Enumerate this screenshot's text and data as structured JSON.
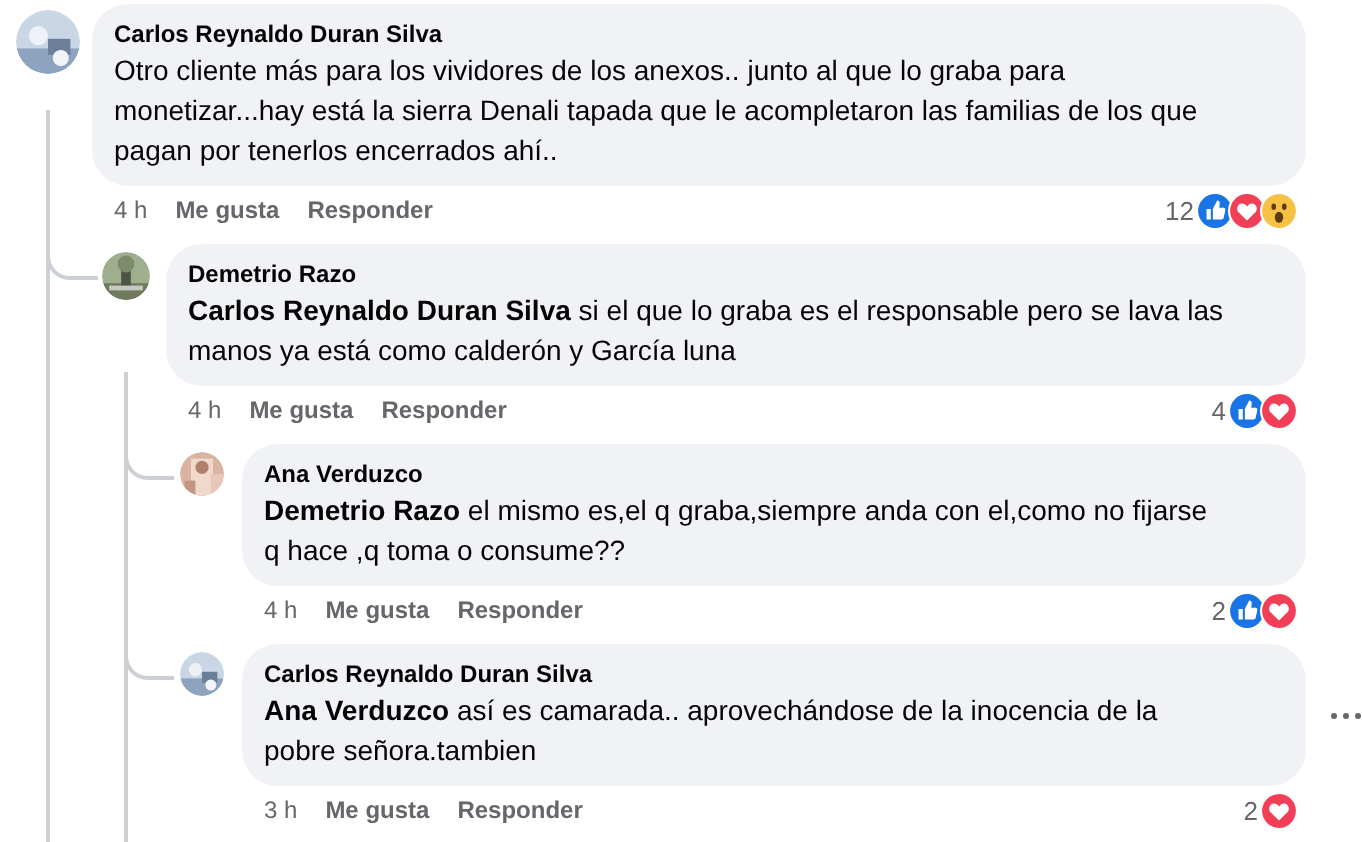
{
  "comments": [
    {
      "author": "Carlos Reynaldo Duran Silva",
      "text": "Otro cliente más para los vividores de los anexos.. junto al que lo graba para monetizar...hay está la sierra Denali tapada que le acompletaron las familias de los que pagan por tenerlos encerrados ahí..",
      "time": "4 h",
      "like": "Me gusta",
      "reply": "Responder",
      "reaction_count": "12",
      "reactions": [
        {
          "kind": "like"
        },
        {
          "kind": "love"
        },
        {
          "kind": "wow"
        }
      ],
      "avatar": {
        "kind": "picture"
      },
      "children": [
        {
          "author": "Demetrio Razo",
          "text": "**Carlos Reynaldo Duran Silva** si el que lo graba es el responsable pero se lava las manos ya está como calderón y García luna",
          "time": "4 h",
          "like": "Me gusta",
          "reply": "Responder",
          "reaction_count": "4",
          "reactions": [
            {
              "kind": "like"
            },
            {
              "kind": "love"
            }
          ],
          "avatar": {
            "kind": "picture"
          },
          "children": [
            {
              "author": "Ana Verduzco",
              "text": "**Demetrio Razo** el mismo es,el q graba,siempre anda con el,como no fijarse q hace ,q toma o consume??",
              "time": "4 h",
              "like": "Me gusta",
              "reply": "Responder",
              "reaction_count": "2",
              "reactions": [
                {
                  "kind": "like"
                },
                {
                  "kind": "love"
                }
              ],
              "avatar": {
                "kind": "picture"
              }
            },
            {
              "author": "Carlos Reynaldo Duran Silva",
              "text": "**Ana Verduzco** así es camarada.. aprovechándose de la inocencia de la pobre señora.tambien",
              "time": "3 h",
              "like": "Me gusta",
              "reply": "Responder",
              "reaction_count": "2",
              "reactions": [
                {
                  "kind": "love"
                }
              ],
              "avatar": {
                "kind": "picture"
              },
              "menu": true
            }
          ]
        }
      ]
    }
  ]
}
